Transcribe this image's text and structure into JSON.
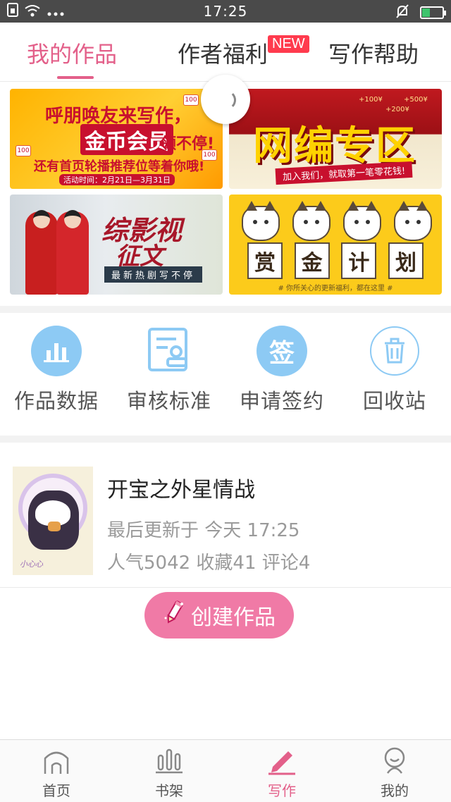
{
  "status_bar": {
    "time": "17:25",
    "left_icons": [
      "sim-icon",
      "wifi-icon",
      "more-dots-icon"
    ],
    "right_icons": [
      "mute-bell-icon",
      "battery-charging-icon"
    ],
    "battery_level": 0.35
  },
  "tabs": [
    {
      "label": "我的作品",
      "active": true
    },
    {
      "label": "作者福利",
      "active": false,
      "badge": "NEW"
    },
    {
      "label": "写作帮助",
      "active": false
    }
  ],
  "banners": {
    "friends": {
      "line1": "呼朋唤友来写作，",
      "line2": "金币会员",
      "line2b": "领不停!",
      "line3": "还有首页轮播推荐位等着你哦!",
      "dates": "活动时间：2月21日—3月31日",
      "coin_label": "100"
    },
    "web_editor": {
      "title": "网编专区",
      "caption": "加入我们，就取第一笔零花钱!",
      "amounts": [
        "+100¥",
        "+500¥",
        "+200¥"
      ]
    },
    "drama": {
      "title1": "综影视",
      "title2": "征文",
      "strip": "最新热剧写不停"
    },
    "bounty": {
      "chars": [
        "赏",
        "金",
        "计",
        "划"
      ],
      "note": "# 你所关心的更新福利，都在这里 #"
    }
  },
  "actions": [
    {
      "label": "作品数据",
      "icon": "bar-chart-icon"
    },
    {
      "label": "审核标准",
      "icon": "review-doc-icon"
    },
    {
      "label": "申请签约",
      "icon": "sign-contract-icon",
      "glyph": "签"
    },
    {
      "label": "回收站",
      "icon": "trash-icon"
    }
  ],
  "work": {
    "title": "开宝之外星情战",
    "updated": "最后更新于 今天 17:25",
    "stats": "人气5042 收藏41 评论4",
    "cover_text": "小心心"
  },
  "create_button": {
    "label": "创建作品",
    "icon": "pencil-icon"
  },
  "bottom_nav": [
    {
      "label": "首页",
      "icon": "home-icon",
      "active": false
    },
    {
      "label": "书架",
      "icon": "bookshelf-icon",
      "active": false
    },
    {
      "label": "写作",
      "icon": "pen-icon",
      "active": true
    },
    {
      "label": "我的",
      "icon": "profile-icon",
      "active": false
    }
  ],
  "colors": {
    "accent": "#e3608a",
    "button": "#f07aa6",
    "icon_blue": "#8dcaf4",
    "new_badge": "#ff3b4e"
  }
}
